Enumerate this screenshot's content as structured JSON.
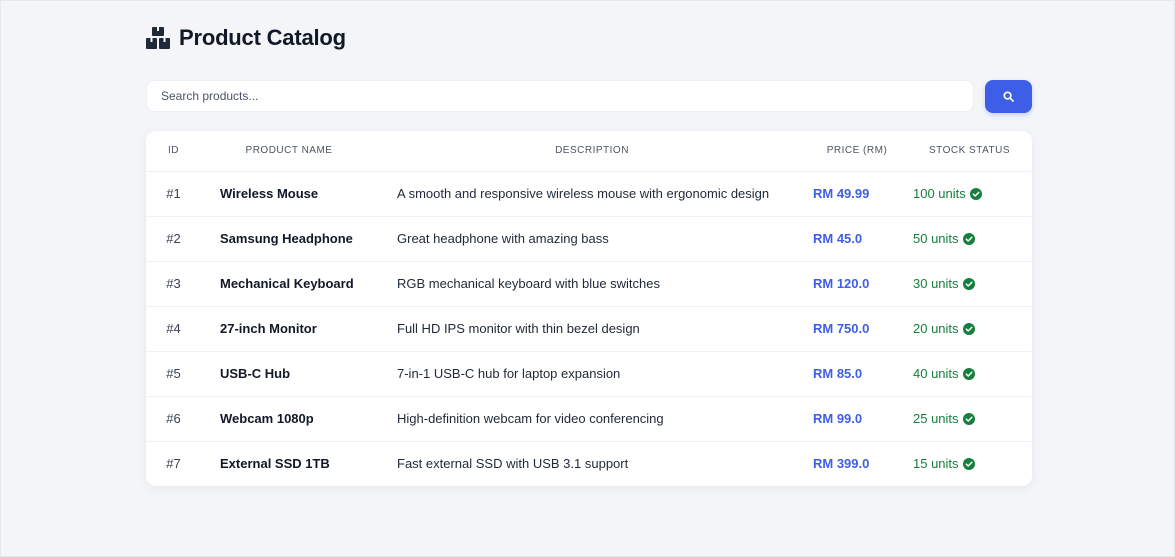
{
  "header": {
    "title": "Product Catalog",
    "icon": "boxes-icon"
  },
  "search": {
    "placeholder": "Search products...",
    "value": "",
    "button_icon": "search-icon"
  },
  "table": {
    "columns": [
      "ID",
      "PRODUCT NAME",
      "DESCRIPTION",
      "PRICE (RM)",
      "STOCK STATUS"
    ],
    "rows": [
      {
        "id": "#1",
        "name": "Wireless Mouse",
        "description": "A smooth and responsive wireless mouse with ergonomic design",
        "price": "RM 49.99",
        "stock": "100 units"
      },
      {
        "id": "#2",
        "name": "Samsung Headphone",
        "description": "Great headphone with amazing bass",
        "price": "RM 45.0",
        "stock": "50 units"
      },
      {
        "id": "#3",
        "name": "Mechanical Keyboard",
        "description": "RGB mechanical keyboard with blue switches",
        "price": "RM 120.0",
        "stock": "30 units"
      },
      {
        "id": "#4",
        "name": "27-inch Monitor",
        "description": "Full HD IPS monitor with thin bezel design",
        "price": "RM 750.0",
        "stock": "20 units"
      },
      {
        "id": "#5",
        "name": "USB-C Hub",
        "description": "7-in-1 USB-C hub for laptop expansion",
        "price": "RM 85.0",
        "stock": "40 units"
      },
      {
        "id": "#6",
        "name": "Webcam 1080p",
        "description": "High-definition webcam for video conferencing",
        "price": "RM 99.0",
        "stock": "25 units"
      },
      {
        "id": "#7",
        "name": "External SSD 1TB",
        "description": "Fast external SSD with USB 3.1 support",
        "price": "RM 399.0",
        "stock": "15 units"
      }
    ],
    "stock_icon": "check-circle-icon"
  },
  "colors": {
    "accent": "#3f5ee8",
    "price": "#3f5ee8",
    "in_stock": "#15803d",
    "background": "#f3f5f9"
  }
}
